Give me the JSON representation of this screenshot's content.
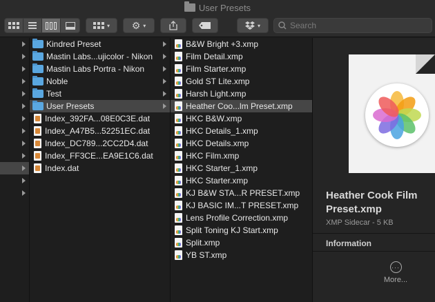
{
  "window": {
    "title": "User Presets"
  },
  "toolbar": {
    "search_placeholder": "Search",
    "view_modes": [
      "icon-view",
      "list-view",
      "column-view",
      "gallery-view"
    ],
    "active_view": "column-view"
  },
  "column1": {
    "rows": [
      "",
      "",
      "",
      "",
      "",
      "",
      "",
      "",
      "",
      "",
      "",
      "",
      ""
    ]
  },
  "column2": {
    "items": [
      {
        "label": "Kindred Preset",
        "type": "folder",
        "arrow": true
      },
      {
        "label": "Mastin Labs...ujicolor - Nikon",
        "type": "folder",
        "arrow": true
      },
      {
        "label": "Mastin Labs Portra - Nikon",
        "type": "folder",
        "arrow": true
      },
      {
        "label": "Noble",
        "type": "folder",
        "arrow": true
      },
      {
        "label": "Test",
        "type": "folder",
        "arrow": true
      },
      {
        "label": "User Presets",
        "type": "folder",
        "arrow": true,
        "selected": true
      },
      {
        "label": "Index_392FA...08E0C3E.dat",
        "type": "dat"
      },
      {
        "label": "Index_A47B5...52251EC.dat",
        "type": "dat"
      },
      {
        "label": "Index_DC789...2CC2D4.dat",
        "type": "dat"
      },
      {
        "label": "Index_FF3CE...EA9E1C6.dat",
        "type": "dat"
      },
      {
        "label": "Index.dat",
        "type": "dat"
      }
    ]
  },
  "column3": {
    "items": [
      {
        "label": "B&W Bright +3.xmp"
      },
      {
        "label": "Film Detail.xmp"
      },
      {
        "label": "Film Starter.xmp"
      },
      {
        "label": "Gold ST Lite.xmp"
      },
      {
        "label": "Harsh Light.xmp"
      },
      {
        "label": "Heather Coo...lm Preset.xmp",
        "selected": true
      },
      {
        "label": "HKC B&W.xmp"
      },
      {
        "label": "HKC Details_1.xmp"
      },
      {
        "label": "HKC Details.xmp"
      },
      {
        "label": "HKC Film.xmp"
      },
      {
        "label": "HKC Starter_1.xmp"
      },
      {
        "label": "HKC Starter.xmp"
      },
      {
        "label": "KJ B&W STA...R PRESET.xmp"
      },
      {
        "label": "KJ BASIC IM...T PRESET.xmp"
      },
      {
        "label": "Lens Profile Correction.xmp"
      },
      {
        "label": "Split Toning KJ Start.xmp"
      },
      {
        "label": "Split.xmp"
      },
      {
        "label": "YB ST.xmp"
      }
    ]
  },
  "preview": {
    "name": "Heather Cook Film Preset.xmp",
    "kind": "XMP Sidecar - 5 KB",
    "section": "Information",
    "more_label": "More..."
  }
}
